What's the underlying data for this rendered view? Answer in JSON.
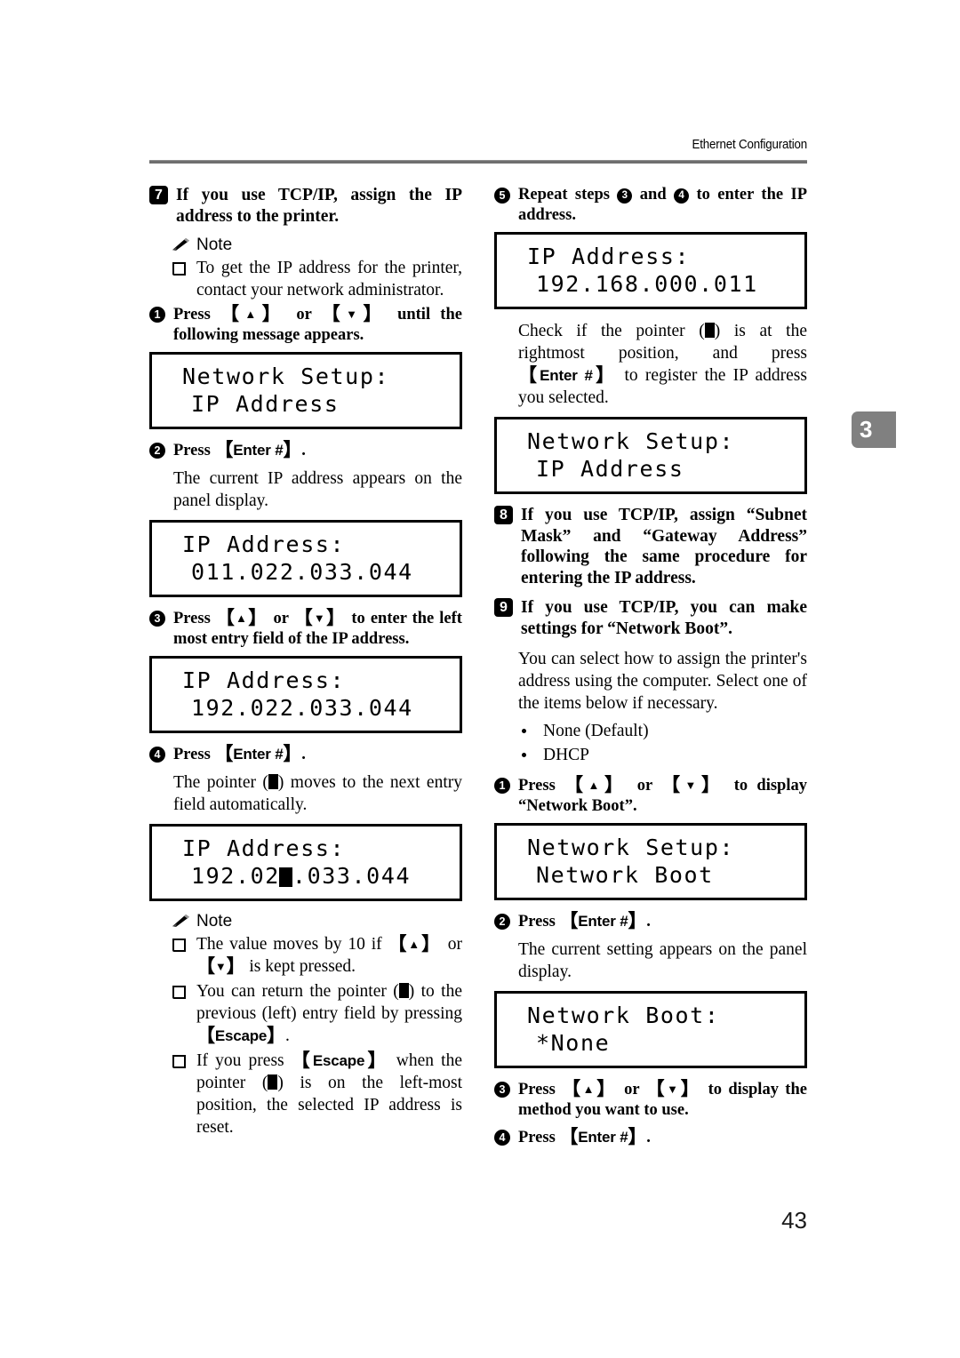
{
  "header": {
    "running_title": "Ethernet Configuration"
  },
  "chapter_tab": {
    "number": "3"
  },
  "footer": {
    "page_number": "43"
  },
  "left_column": {
    "step7": {
      "marker": "7",
      "text": "If you use TCP/IP, assign the IP address to the printer."
    },
    "note1": {
      "label": "Note",
      "items": [
        "To get the IP address for the printer, contact your network administrator."
      ]
    },
    "step1": {
      "marker": "1",
      "prefix": "Press ",
      "key_up": "▲",
      "mid": " or ",
      "key_down": "▼",
      "suffix": " until the following message appears."
    },
    "lcd1": {
      "line1": "Network Setup:",
      "line2": "IP Address"
    },
    "step2": {
      "marker": "2",
      "prefix": "Press ",
      "key": "Enter #",
      "suffix": "."
    },
    "step2_body": "The current IP address appears on the panel display.",
    "lcd2": {
      "line1": "IP Address:",
      "line2": "011.022.033.044"
    },
    "step3": {
      "marker": "3",
      "prefix": "Press ",
      "key_up": "▲",
      "mid": " or ",
      "key_down": "▼",
      "suffix": " to enter the left most entry field of the IP address."
    },
    "lcd3": {
      "line1": "IP Address:",
      "line2": "192.022.033.044"
    },
    "step4": {
      "marker": "4",
      "prefix": "Press ",
      "key": "Enter #",
      "suffix": "."
    },
    "step4_body_a": "The pointer (",
    "step4_body_b": ") moves to the next entry field automatically.",
    "lcd4": {
      "line2_before": "192.02",
      "line2_after": ".033.044",
      "line1": "IP Address:"
    },
    "note2": {
      "label": "Note",
      "item1_a": "The value moves by 10 if ",
      "item1_key_up": "▲",
      "item1_b": " or ",
      "item1_key_down": "▼",
      "item1_c": " is kept pressed.",
      "item2_a": "You can return the pointer (",
      "item2_b": ") to the previous (left) entry field by pressing ",
      "item2_key": "Escape",
      "item2_c": ".",
      "item3_a": "If you press ",
      "item3_key": "Escape",
      "item3_b": " when the pointer (",
      "item3_c": ") is on the left-most position, the selected IP address is reset."
    }
  },
  "right_column": {
    "step5": {
      "marker": "5",
      "prefix": "Repeat steps ",
      "ref_a": "3",
      "mid": " and ",
      "ref_b": "4",
      "suffix": " to enter the IP address."
    },
    "lcd5": {
      "line1": "IP Address:",
      "line2": "192.168.000.011"
    },
    "step5_body_a": "Check if the pointer (",
    "step5_body_b": ") is at the rightmost position, and press ",
    "step5_body_key": "Enter #",
    "step5_body_c": " to register the IP address you selected.",
    "lcd6": {
      "line1": "Network Setup:",
      "line2": "IP Address"
    },
    "step8": {
      "marker": "8",
      "text": "If you use TCP/IP, assign “Subnet Mask” and “Gateway Address” following the same procedure for entering the IP address."
    },
    "step9": {
      "marker": "9",
      "text": "If you use TCP/IP, you can make settings for “Network Boot”."
    },
    "step9_body": "You can select how to assign the printer's address using the computer. Select one of the items below if necessary.",
    "options": [
      "None (Default)",
      "DHCP"
    ],
    "sub1": {
      "marker": "1",
      "prefix": "Press ",
      "key_up": "▲",
      "mid": " or ",
      "key_down": "▼",
      "suffix": " to display “Network Boot”."
    },
    "lcd7": {
      "line1": "Network Setup:",
      "line2": "Network Boot"
    },
    "sub2": {
      "marker": "2",
      "prefix": "Press ",
      "key": "Enter #",
      "suffix": "."
    },
    "sub2_body": "The current setting appears on the panel display.",
    "lcd8": {
      "line1": "Network Boot:",
      "line2": "*None"
    },
    "sub3": {
      "marker": "3",
      "prefix": "Press ",
      "key_up": "▲",
      "mid": " or ",
      "key_down": "▼",
      "suffix": " to display the method you want to use."
    },
    "sub4": {
      "marker": "4",
      "prefix": "Press ",
      "key": "Enter #",
      "suffix": "."
    }
  }
}
